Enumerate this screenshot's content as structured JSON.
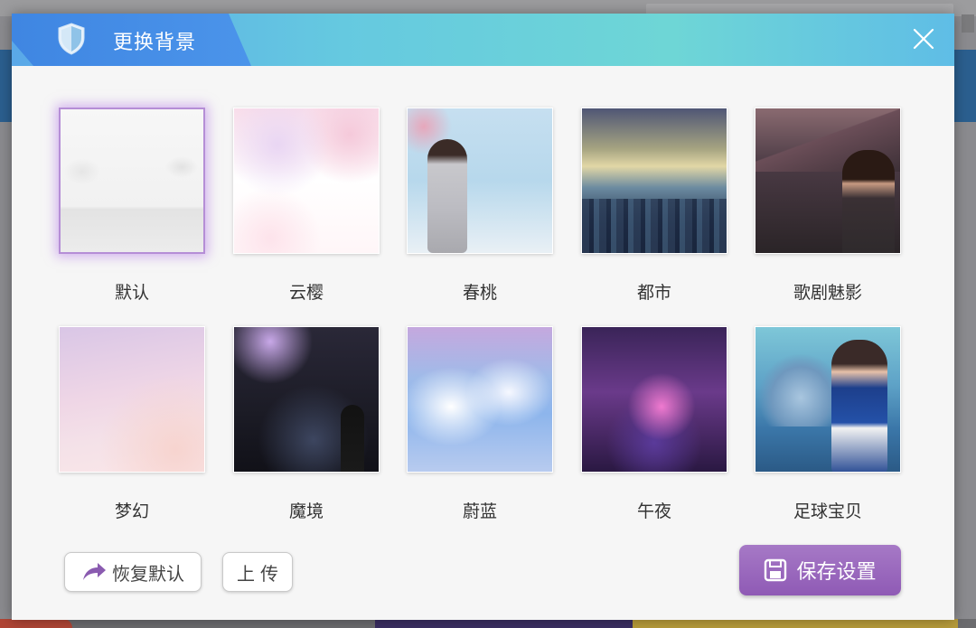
{
  "dialog": {
    "title": "更换背景",
    "close_label": "×"
  },
  "backgrounds": [
    {
      "label": "默认",
      "art": "default",
      "selected": true
    },
    {
      "label": "云樱",
      "art": "sakura",
      "selected": false
    },
    {
      "label": "春桃",
      "art": "peach",
      "selected": false
    },
    {
      "label": "都市",
      "art": "city",
      "selected": false
    },
    {
      "label": "歌剧魅影",
      "art": "opera",
      "selected": false
    },
    {
      "label": "梦幻",
      "art": "dream",
      "selected": false
    },
    {
      "label": "魔境",
      "art": "magic",
      "selected": false
    },
    {
      "label": "蔚蓝",
      "art": "blue",
      "selected": false
    },
    {
      "label": "午夜",
      "art": "midnight",
      "selected": false
    },
    {
      "label": "足球宝贝",
      "art": "football",
      "selected": false
    }
  ],
  "actions": {
    "restore_label": "恢复默认",
    "upload_label": "上传",
    "save_label": "保存设置"
  },
  "icons": {
    "shield": "shield-icon",
    "close": "close-icon",
    "restore": "share-arrow-icon",
    "save": "floppy-disk-icon"
  },
  "colors": {
    "header_start": "#3f86e2",
    "header_end": "#6ed6d6",
    "selection_glow": "#b58ed6",
    "save_button": "#9a66bd"
  }
}
